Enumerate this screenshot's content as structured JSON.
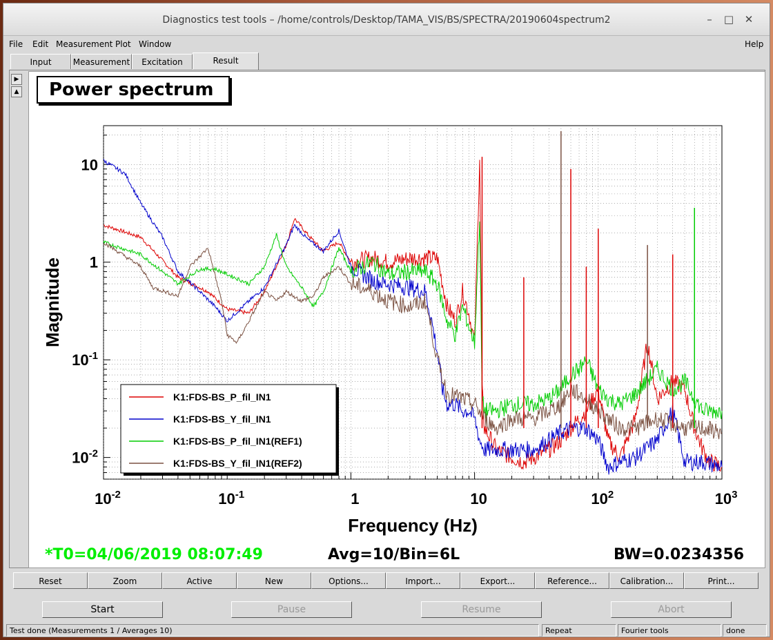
{
  "window": {
    "title": "Diagnostics test tools – /home/controls/Desktop/TAMA_VIS/BS/SPECTRA/20190604spectrum2",
    "min_glyph": "–",
    "max_glyph": "□",
    "close_glyph": "✕"
  },
  "menu": {
    "file": "File",
    "edit": "Edit",
    "measurement": "Measurement",
    "plot": "Plot",
    "window": "Window",
    "help": "Help"
  },
  "tabs": [
    "Input",
    "Measurement",
    "Excitation",
    "Result"
  ],
  "active_tab": "Result",
  "plot_title": "Power spectrum",
  "status": {
    "t0": "*T0=04/06/2019 08:07:49",
    "avg": "Avg=10/Bin=6L",
    "bw": "BW=0.0234356"
  },
  "buttons": [
    "Reset",
    "Zoom",
    "Active",
    "New",
    "Options...",
    "Import...",
    "Export...",
    "Reference...",
    "Calibration...",
    "Print..."
  ],
  "controls": {
    "start": "Start",
    "pause": "Pause",
    "resume": "Resume",
    "abort": "Abort"
  },
  "statusbar": {
    "message": "Test done (Measurements 1 / Averages 10)",
    "repeat": "Repeat",
    "fourier": "Fourier tools",
    "done": "done"
  },
  "chart_data": {
    "type": "line",
    "xlabel": "Frequency (Hz)",
    "ylabel": "Magnitude",
    "xscale": "log",
    "yscale": "log",
    "xlim": [
      0.01,
      1000
    ],
    "ylim": [
      0.006,
      25
    ],
    "xticks": [
      "10^-2",
      "10^-1",
      "1",
      "10",
      "10^2",
      "10^3"
    ],
    "yticks": [
      "10^-2",
      "10^-1",
      "1",
      "10"
    ],
    "grid": true,
    "legend_position": "lower-left",
    "series": [
      {
        "name": "K1:FDS-BS_P_fil_IN1",
        "color": "#dd0000",
        "x": [
          0.01,
          0.02,
          0.04,
          0.07,
          0.1,
          0.15,
          0.2,
          0.3,
          0.35,
          0.45,
          0.6,
          0.8,
          1,
          1.5,
          2,
          3,
          4,
          5,
          6,
          7,
          8,
          9,
          10,
          11,
          11.5,
          12,
          15,
          20,
          25,
          30,
          40,
          50,
          60,
          70,
          80,
          100,
          120,
          150,
          200,
          250,
          300,
          400,
          500,
          600,
          700,
          800,
          1000
        ],
        "y": [
          2.4,
          1.8,
          0.7,
          0.5,
          0.33,
          0.3,
          0.5,
          1.5,
          2.8,
          1.9,
          1.3,
          1.6,
          1.0,
          1.1,
          1.0,
          1.1,
          1.1,
          1.1,
          0.35,
          0.25,
          0.5,
          0.3,
          0.15,
          12,
          0.05,
          0.02,
          0.012,
          0.01,
          0.009,
          0.01,
          0.012,
          0.015,
          0.02,
          0.025,
          0.03,
          0.05,
          0.015,
          0.01,
          0.025,
          0.15,
          0.04,
          0.06,
          0.05,
          0.02,
          0.012,
          0.009,
          0.008
        ]
      },
      {
        "name": "K1:FDS-BS_Y_fil_IN1",
        "color": "#0000cc",
        "x": [
          0.01,
          0.015,
          0.02,
          0.03,
          0.04,
          0.06,
          0.08,
          0.1,
          0.15,
          0.2,
          0.3,
          0.35,
          0.45,
          0.6,
          0.8,
          1,
          1.5,
          2,
          3,
          4,
          4.5,
          5,
          5.5,
          6,
          7,
          8,
          9,
          10,
          11,
          12,
          15,
          20,
          30,
          40,
          50,
          60,
          80,
          100,
          120,
          150,
          200,
          300,
          400,
          500,
          700,
          1000
        ],
        "y": [
          11,
          8,
          4,
          1.8,
          0.8,
          0.5,
          0.35,
          0.25,
          0.4,
          0.55,
          1.5,
          2.4,
          1.7,
          1.3,
          2.1,
          0.9,
          0.65,
          0.6,
          0.55,
          0.5,
          0.25,
          0.12,
          0.05,
          0.035,
          0.035,
          0.03,
          0.03,
          0.025,
          0.015,
          0.012,
          0.012,
          0.012,
          0.012,
          0.015,
          0.018,
          0.02,
          0.02,
          0.015,
          0.008,
          0.009,
          0.01,
          0.015,
          0.03,
          0.009,
          0.009,
          0.008
        ]
      },
      {
        "name": "K1:FDS-BS_P_fil_IN1(REF1)",
        "color": "#00cc00",
        "x": [
          0.01,
          0.02,
          0.04,
          0.06,
          0.08,
          0.1,
          0.15,
          0.2,
          0.25,
          0.3,
          0.4,
          0.5,
          0.6,
          0.8,
          1,
          1.5,
          2,
          3,
          4,
          5,
          6,
          7,
          8,
          9,
          10,
          11,
          11.5,
          12,
          15,
          20,
          30,
          40,
          50,
          60,
          70,
          80,
          100,
          120,
          150,
          200,
          300,
          400,
          500,
          600,
          700,
          1000
        ],
        "y": [
          1.6,
          1.2,
          0.6,
          0.85,
          0.85,
          0.75,
          0.6,
          0.9,
          1.9,
          0.9,
          0.55,
          0.35,
          0.5,
          1.4,
          0.8,
          1.0,
          0.75,
          0.8,
          0.8,
          0.6,
          0.25,
          0.18,
          0.35,
          0.22,
          0.15,
          3,
          0.04,
          0.03,
          0.03,
          0.035,
          0.035,
          0.04,
          0.05,
          0.07,
          0.08,
          0.1,
          0.05,
          0.04,
          0.035,
          0.045,
          0.08,
          0.05,
          0.06,
          0.04,
          0.03,
          0.03
        ]
      },
      {
        "name": "K1:FDS-BS_Y_fil_IN1(REF2)",
        "color": "#7a5040",
        "x": [
          0.01,
          0.02,
          0.025,
          0.04,
          0.05,
          0.07,
          0.09,
          0.1,
          0.12,
          0.15,
          0.2,
          0.25,
          0.3,
          0.4,
          0.5,
          0.6,
          0.8,
          1,
          1.5,
          2,
          3,
          4,
          4.5,
          5,
          6,
          8,
          10,
          12,
          15,
          20,
          30,
          40,
          50,
          60,
          80,
          100,
          150,
          200,
          300,
          400,
          500,
          700,
          1000
        ],
        "y": [
          1.6,
          0.9,
          0.55,
          0.45,
          0.9,
          1.4,
          0.4,
          0.18,
          0.15,
          0.25,
          0.5,
          0.4,
          0.5,
          0.4,
          0.45,
          0.7,
          0.9,
          0.6,
          0.5,
          0.4,
          0.35,
          0.4,
          0.2,
          0.1,
          0.045,
          0.04,
          0.035,
          0.025,
          0.02,
          0.025,
          0.025,
          0.03,
          0.035,
          0.05,
          0.04,
          0.03,
          0.02,
          0.02,
          0.025,
          0.022,
          0.02,
          0.02,
          0.018
        ]
      }
    ],
    "peaks": [
      {
        "series": 0,
        "x": 11.5,
        "y": 12
      },
      {
        "series": 0,
        "x": 25,
        "y": 0.7
      },
      {
        "series": 3,
        "x": 50,
        "y": 22
      },
      {
        "series": 0,
        "x": 60,
        "y": 9
      },
      {
        "series": 0,
        "x": 80,
        "y": 0.9
      },
      {
        "series": 0,
        "x": 100,
        "y": 2.2
      },
      {
        "series": 3,
        "x": 250,
        "y": 1.5
      },
      {
        "series": 0,
        "x": 400,
        "y": 1.2
      },
      {
        "series": 2,
        "x": 600,
        "y": 3.6
      }
    ]
  }
}
